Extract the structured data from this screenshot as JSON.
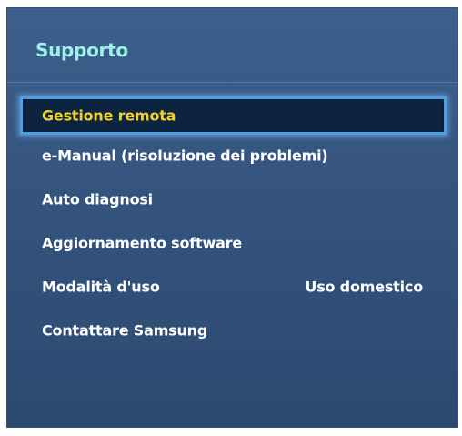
{
  "panel": {
    "title": "Supporto"
  },
  "menu": {
    "items": [
      {
        "label": "Gestione remota",
        "value": "",
        "selected": true
      },
      {
        "label": "e-Manual (risoluzione dei problemi)",
        "value": "",
        "selected": false
      },
      {
        "label": "Auto diagnosi",
        "value": "",
        "selected": false
      },
      {
        "label": "Aggiornamento software",
        "value": "",
        "selected": false
      },
      {
        "label": "Modalità d'uso",
        "value": "Uso domestico",
        "selected": false
      },
      {
        "label": "Contattare Samsung",
        "value": "",
        "selected": false
      }
    ]
  },
  "colors": {
    "title": "#9ef0ea",
    "selected_text": "#f5d22a",
    "selected_border": "#4ca0e6",
    "item_text": "#ffffff",
    "panel_background": "#3a5a86"
  }
}
